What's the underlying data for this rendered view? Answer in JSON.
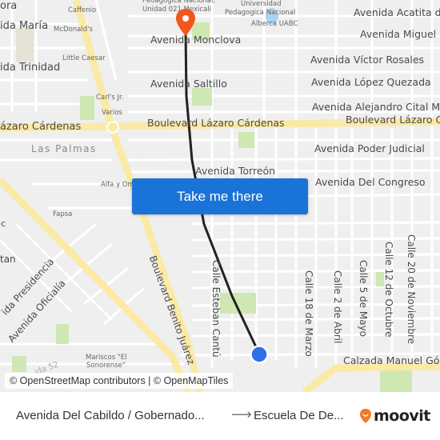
{
  "map": {
    "streets": {
      "avenida_maria": "ida María",
      "avenida_trinidad": "ida Trinidad",
      "lazaro_left": "ázaro Cárdenas",
      "lazaro_right": "Boulevard Lázaro Cárdenas",
      "avenida_monclova": "Avenida Monclova",
      "avenida_saltillo": "Avenida Saltillo",
      "avenida_acatita": "Avenida Acatita de",
      "avenida_miguel": "Avenida Miguel B",
      "avenida_victor_rosales": "Avenida Víctor Rosales",
      "avenida_lopez_quezada": "Avenida López Quezada",
      "avenida_alejandro": "Avenida Alejandro Cital Mer",
      "avenida_poder_judicial": "Avenida Poder Judicial",
      "avenida_torreon": "Avenida Torreón",
      "avenida_del_congreso": "Avenida Del Congreso",
      "boulevard_benito_juarez": "Boulevard Benito Juárez",
      "calle_esteban_cantu": "Calle Esteban Cantú",
      "calle_18_marzo": "Calle 18 de Marzo",
      "calle_2_abril": "Calle 2 de Abril",
      "calle_5_mayo": "Calle 5 de Mayo",
      "calle_12_octubre": "Calle 12 de Octubre",
      "calle_20_noviembre": "Calle 20 de Noviembre",
      "calzada_manuel": "Calzada Manuel Góm",
      "avenida_presidencia": "ida Presidencia",
      "avenida_oficialia": "Avenida Oficialía",
      "edge_c": "c",
      "edge_tan": "tan",
      "edge_ora": "ora",
      "avenida_52": "ida 52"
    },
    "districts": {
      "las_palmas": "Las Palmas"
    },
    "pois": {
      "caffenio": "Caffenio",
      "mcdonalds": "McDonald's",
      "little_caesar": "Little Caesar",
      "carls_jr": "Carl's Jr.",
      "varios": "Varios",
      "alfa_omega": "Alfa y Om",
      "fapsa": "Fapsa",
      "upn_line1": "Pedagogica Nacional,",
      "upn_line2": "Unidad 021 Mexicali",
      "universidad_line1": "Universidad",
      "universidad_line2": "Pedagogica Nacional",
      "alberca_uabc": "Alberca UABC",
      "mariscos_line1": "Mariscos \"El",
      "mariscos_line2": "Sonorense\""
    },
    "attribution": "© OpenStreetMap contributors | © OpenMapTiles",
    "colors": {
      "background": "#efefef",
      "road": "#ffffff",
      "major_road": "#fbe9a6",
      "park": "#cfe8b3",
      "water": "#aad3f0",
      "route_line": "#222222",
      "destination_pin": "#f2561d",
      "origin_dot": "#2f6fe8"
    }
  },
  "cta": {
    "label": "Take me there",
    "color": "#1a73d8"
  },
  "footer": {
    "from": "Avenida Del Cabildo / Gobernado...",
    "arrow": "⟶",
    "to": "Escuela De De...",
    "logo_text": "moovit",
    "logo_color": "#f47a22"
  }
}
